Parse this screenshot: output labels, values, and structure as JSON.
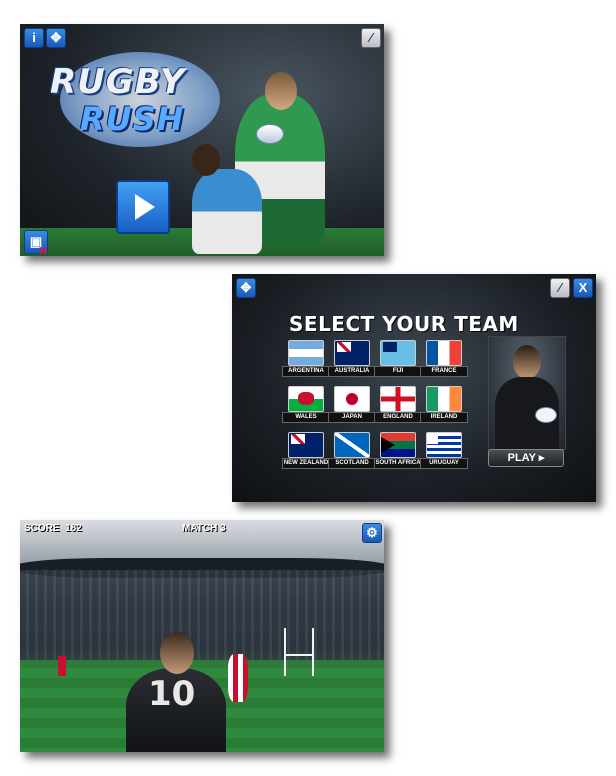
{
  "screen1": {
    "logo_line1": "RUGBY",
    "logo_line2": "RUSH",
    "buttons": {
      "info": "i",
      "fullscreen": "fullscreen-icon",
      "sound": "sound-off-icon",
      "play": "play-icon",
      "save": "save-icon"
    }
  },
  "screen2": {
    "title": "SELECT YOUR TEAM",
    "teams": [
      {
        "name": "ARGENTINA"
      },
      {
        "name": "AUSTRALIA"
      },
      {
        "name": "FIJI"
      },
      {
        "name": "FRANCE"
      },
      {
        "name": "WALES"
      },
      {
        "name": "JAPAN"
      },
      {
        "name": "ENGLAND"
      },
      {
        "name": "IRELAND"
      },
      {
        "name": "NEW ZEALAND"
      },
      {
        "name": "SCOTLAND"
      },
      {
        "name": "SOUTH AFRICA"
      },
      {
        "name": "URUGUAY"
      }
    ],
    "play_label": "PLAY",
    "close_label": "X"
  },
  "screen3": {
    "score_label": "SCORE",
    "score_value": "182",
    "match_label": "MATCH 3",
    "player_number": "10"
  },
  "colors": {
    "button_blue": "#1a58b8",
    "pitch_green": "#2c8b3c"
  }
}
